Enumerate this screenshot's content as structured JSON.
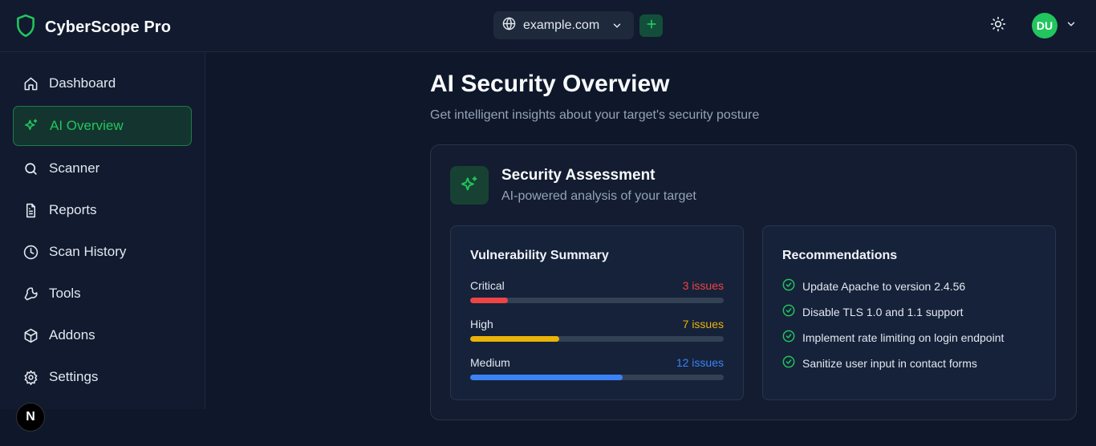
{
  "header": {
    "brand": "CyberScope Pro",
    "domain": "example.com",
    "avatar_initials": "DU"
  },
  "sidebar": {
    "items": [
      {
        "label": "Dashboard",
        "icon": "home-icon",
        "active": false
      },
      {
        "label": "AI Overview",
        "icon": "sparkles-icon",
        "active": true
      },
      {
        "label": "Scanner",
        "icon": "search-icon",
        "active": false
      },
      {
        "label": "Reports",
        "icon": "file-text-icon",
        "active": false
      },
      {
        "label": "Scan History",
        "icon": "clock-icon",
        "active": false
      },
      {
        "label": "Tools",
        "icon": "wrench-icon",
        "active": false
      },
      {
        "label": "Addons",
        "icon": "package-icon",
        "active": false
      },
      {
        "label": "Settings",
        "icon": "gear-icon",
        "active": false
      }
    ],
    "badge": "N"
  },
  "main": {
    "title": "AI Security Overview",
    "subtitle": "Get intelligent insights about your target's security posture",
    "card": {
      "title": "Security Assessment",
      "subtitle": "AI-powered analysis of your target",
      "vulnerability_summary": {
        "title": "Vulnerability Summary",
        "rows": [
          {
            "label": "Critical",
            "count": "3 issues",
            "level": 0.15,
            "color": "#ef4444"
          },
          {
            "label": "High",
            "count": "7 issues",
            "level": 0.35,
            "color": "#eab308"
          },
          {
            "label": "Medium",
            "count": "12 issues",
            "level": 0.6,
            "color": "#3b82f6"
          }
        ]
      },
      "recommendations": {
        "title": "Recommendations",
        "items": [
          "Update Apache to version 2.4.56",
          "Disable TLS 1.0 and 1.1 support",
          "Implement rate limiting on login endpoint",
          "Sanitize user input in contact forms"
        ]
      }
    }
  },
  "colors": {
    "accent": "#22c55e",
    "background": "#0f172a",
    "critical": "#ef4444",
    "high": "#eab308",
    "medium": "#3b82f6"
  }
}
